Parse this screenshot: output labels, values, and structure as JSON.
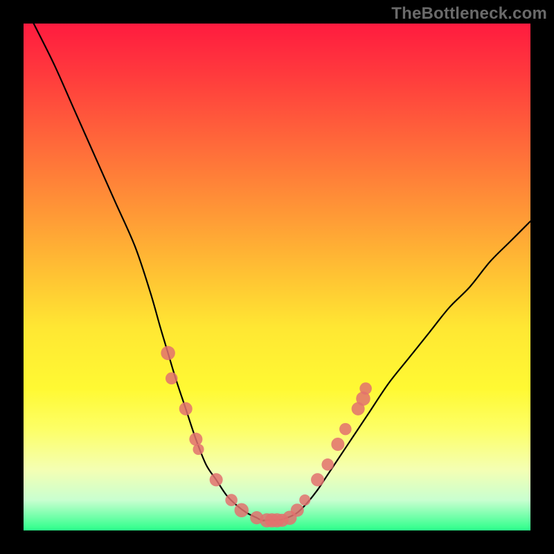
{
  "watermark": "TheBottleneck.com",
  "chart_data": {
    "type": "line",
    "title": "",
    "xlabel": "",
    "ylabel": "",
    "xlim": [
      0,
      100
    ],
    "ylim": [
      0,
      100
    ],
    "background_gradient": {
      "top": "#ff1b3f",
      "mid": "#ffe733",
      "bottom": "#2bff8a"
    },
    "series": [
      {
        "name": "bottleneck-curve",
        "x": [
          2,
          6,
          10,
          14,
          18,
          22,
          25,
          27,
          28.5,
          30,
          32,
          34,
          36,
          38,
          40,
          42,
          44,
          46,
          47,
          48,
          50,
          52,
          54,
          56,
          58,
          60,
          64,
          68,
          72,
          76,
          80,
          84,
          88,
          92,
          96,
          100
        ],
        "y": [
          100,
          92,
          83,
          74,
          65,
          56,
          47,
          40,
          35,
          30,
          24,
          18,
          13,
          10,
          7,
          5,
          3.5,
          2.5,
          2,
          2,
          2,
          2.5,
          3.5,
          5.5,
          8,
          11,
          17,
          23,
          29,
          34,
          39,
          44,
          48,
          53,
          57,
          61
        ]
      }
    ],
    "scatter": [
      {
        "name": "marker-dots",
        "points": [
          {
            "x": 28.5,
            "y": 35,
            "r": 1.4
          },
          {
            "x": 29.2,
            "y": 30,
            "r": 1.2
          },
          {
            "x": 32,
            "y": 24,
            "r": 1.3
          },
          {
            "x": 34,
            "y": 18,
            "r": 1.3
          },
          {
            "x": 34.5,
            "y": 16,
            "r": 1.1
          },
          {
            "x": 38,
            "y": 10,
            "r": 1.3
          },
          {
            "x": 41,
            "y": 6,
            "r": 1.2
          },
          {
            "x": 43,
            "y": 4,
            "r": 1.4
          },
          {
            "x": 46,
            "y": 2.5,
            "r": 1.3
          },
          {
            "x": 48,
            "y": 2,
            "r": 1.4
          },
          {
            "x": 49,
            "y": 2,
            "r": 1.4
          },
          {
            "x": 50,
            "y": 2,
            "r": 1.4
          },
          {
            "x": 51,
            "y": 2,
            "r": 1.3
          },
          {
            "x": 52.5,
            "y": 2.5,
            "r": 1.4
          },
          {
            "x": 54,
            "y": 4,
            "r": 1.3
          },
          {
            "x": 55.5,
            "y": 6,
            "r": 1.1
          },
          {
            "x": 58,
            "y": 10,
            "r": 1.3
          },
          {
            "x": 60,
            "y": 13,
            "r": 1.2
          },
          {
            "x": 62,
            "y": 17,
            "r": 1.3
          },
          {
            "x": 63.5,
            "y": 20,
            "r": 1.2
          },
          {
            "x": 66,
            "y": 24,
            "r": 1.3
          },
          {
            "x": 67,
            "y": 26,
            "r": 1.4
          },
          {
            "x": 67.5,
            "y": 28,
            "r": 1.2
          }
        ]
      }
    ]
  }
}
